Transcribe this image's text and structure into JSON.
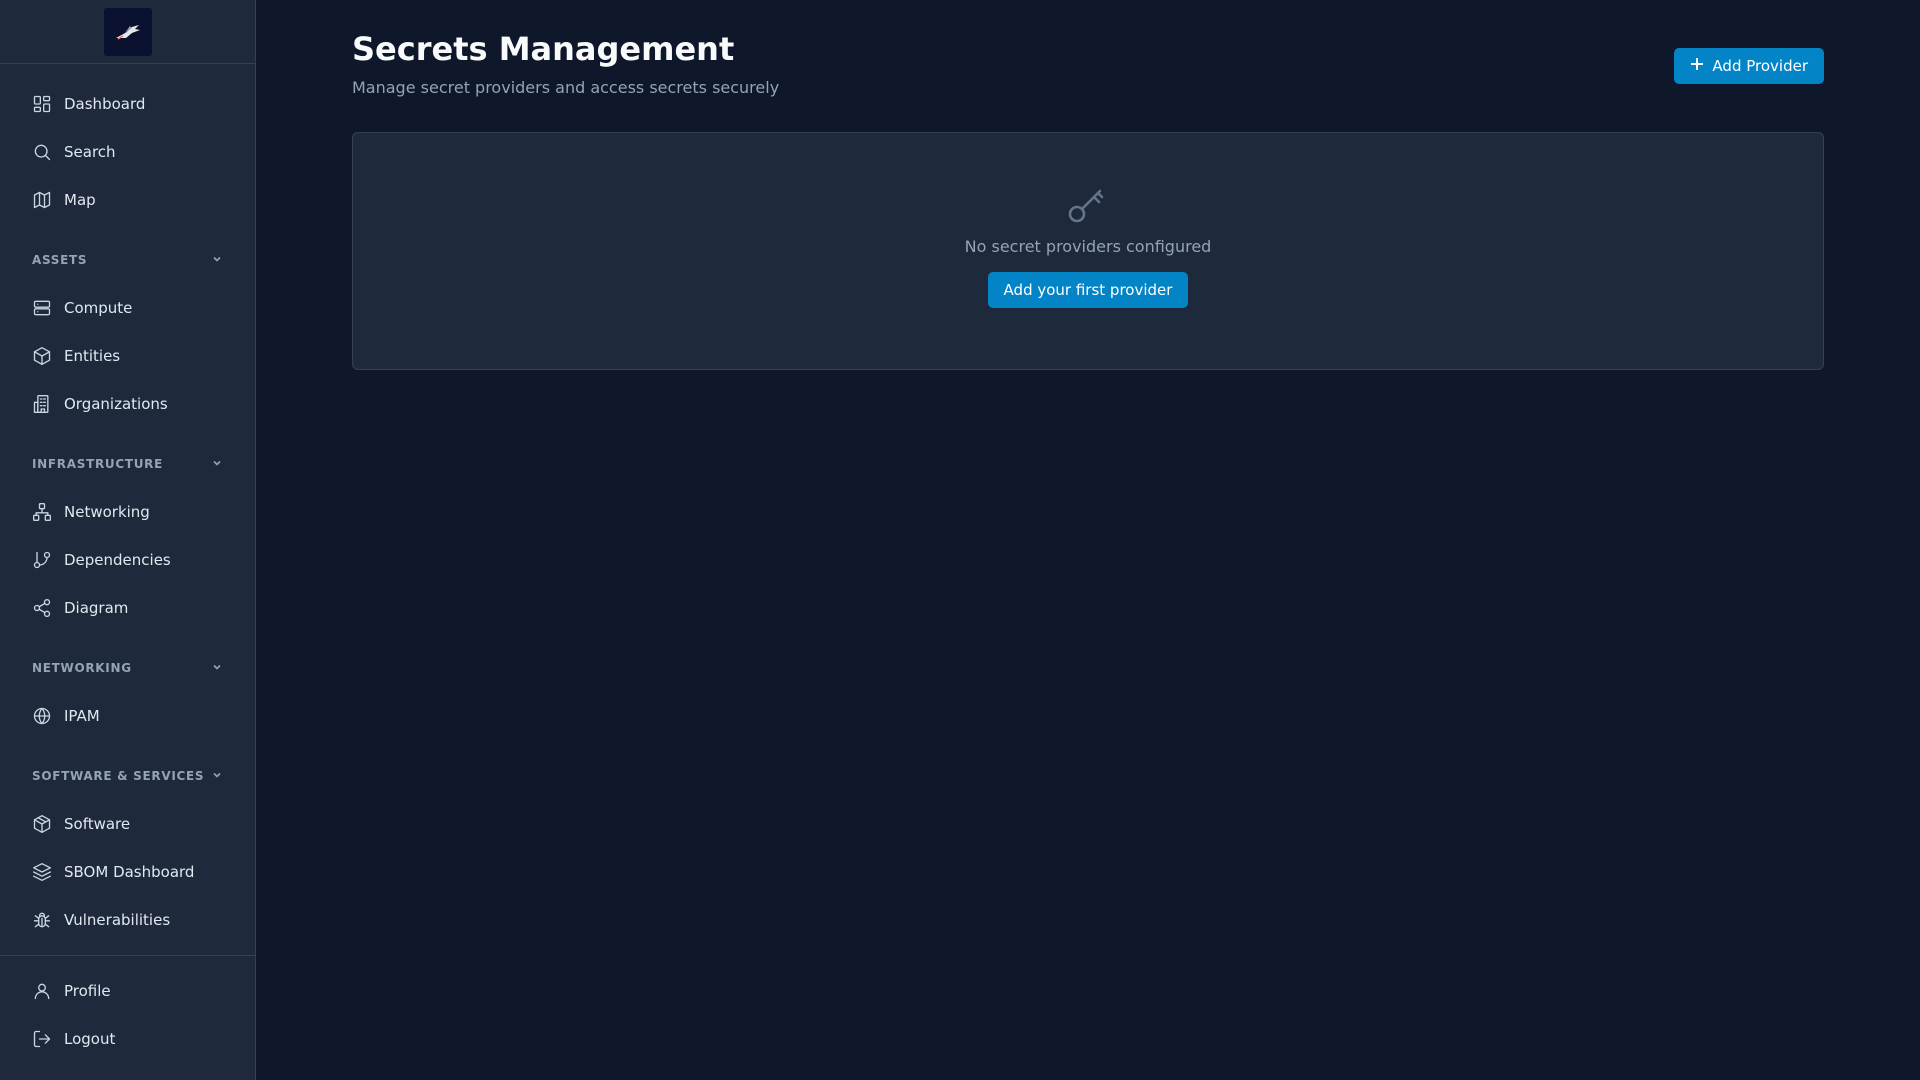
{
  "sidebar": {
    "logo_icon": "bird-logo-icon",
    "top_items": [
      {
        "label": "Dashboard",
        "icon": "dashboard-icon"
      },
      {
        "label": "Search",
        "icon": "search-icon"
      },
      {
        "label": "Map",
        "icon": "map-icon"
      }
    ],
    "sections": [
      {
        "title": "ASSETS",
        "items": [
          {
            "label": "Compute",
            "icon": "server-icon"
          },
          {
            "label": "Entities",
            "icon": "box-icon"
          },
          {
            "label": "Organizations",
            "icon": "building-icon"
          }
        ]
      },
      {
        "title": "INFRASTRUCTURE",
        "items": [
          {
            "label": "Networking",
            "icon": "network-icon"
          },
          {
            "label": "Dependencies",
            "icon": "git-branch-icon"
          },
          {
            "label": "Diagram",
            "icon": "share-icon"
          }
        ]
      },
      {
        "title": "NETWORKING",
        "items": [
          {
            "label": "IPAM",
            "icon": "globe-icon"
          }
        ]
      },
      {
        "title": "SOFTWARE & SERVICES",
        "items": [
          {
            "label": "Software",
            "icon": "package-icon"
          },
          {
            "label": "SBOM Dashboard",
            "icon": "layers-icon"
          },
          {
            "label": "Vulnerabilities",
            "icon": "bug-icon"
          }
        ]
      }
    ],
    "bottom_items": [
      {
        "label": "Profile",
        "icon": "user-icon"
      },
      {
        "label": "Logout",
        "icon": "logout-icon"
      }
    ]
  },
  "header": {
    "title": "Secrets Management",
    "subtitle": "Manage secret providers and access secrets securely",
    "add_button_label": "Add Provider"
  },
  "empty_state": {
    "icon": "key-icon",
    "message": "No secret providers configured",
    "button_label": "Add your first provider"
  },
  "colors": {
    "background": "#0f172a",
    "sidebar": "#1e293b",
    "accent": "#0284c7"
  }
}
